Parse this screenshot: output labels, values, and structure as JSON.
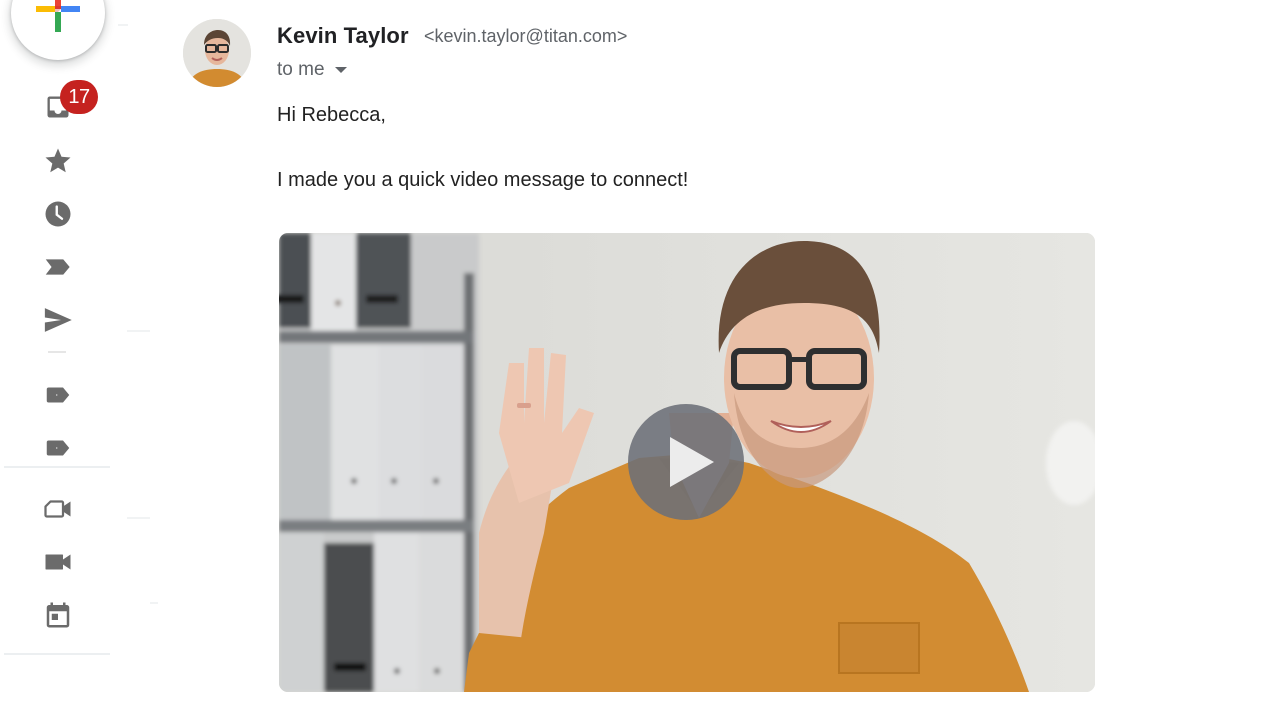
{
  "sidebar": {
    "compose": {
      "label": "Compose",
      "icon": "plus-multicolor-icon",
      "colors": [
        "#ea4335",
        "#4285f4",
        "#34a853",
        "#fbbc04"
      ]
    },
    "items": [
      {
        "name": "inbox",
        "icon": "inbox-icon",
        "badge": "17"
      },
      {
        "name": "starred",
        "icon": "star-icon"
      },
      {
        "name": "snoozed",
        "icon": "clock-icon"
      },
      {
        "name": "important",
        "icon": "label-important-icon"
      },
      {
        "name": "sent",
        "icon": "send-icon"
      },
      {
        "name": "label-1",
        "icon": "label-icon"
      },
      {
        "name": "label-2",
        "icon": "label-icon"
      },
      {
        "name": "meet-new",
        "icon": "video-outline-icon"
      },
      {
        "name": "meet-join",
        "icon": "video-filled-icon"
      },
      {
        "name": "calendar",
        "icon": "calendar-icon"
      }
    ],
    "badge_color": "#c5221f",
    "icon_color": "#6b6b6b"
  },
  "email": {
    "sender_name": "Kevin Taylor",
    "sender_email": "<kevin.taylor@titan.com>",
    "recipient": "to me",
    "greeting": "Hi Rebecca,",
    "body": "I made you a quick video message to connect!",
    "video": {
      "action": "Play video",
      "icon": "play-icon",
      "shirt_color": "#d58f33"
    }
  }
}
